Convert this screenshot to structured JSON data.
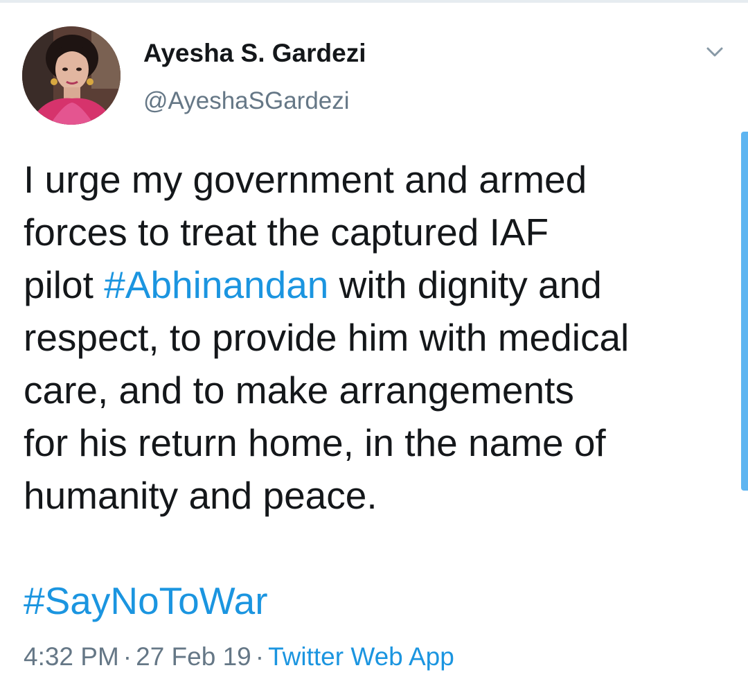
{
  "tweet": {
    "author": {
      "display_name": "Ayesha S. Gardezi",
      "handle": "@AyeshaSGardezi"
    },
    "text_lines": [
      {
        "before": "I urge my government and armed",
        "hashtag": "",
        "after": ""
      },
      {
        "before": "forces to treat the captured IAF",
        "hashtag": "",
        "after": ""
      },
      {
        "before": "pilot ",
        "hashtag": "#Abhinandan",
        "after": " with dignity and"
      },
      {
        "before": "respect, to provide him with medical",
        "hashtag": "",
        "after": ""
      },
      {
        "before": "care, and to make arrangements",
        "hashtag": "",
        "after": ""
      },
      {
        "before": "for his return home, in the name of",
        "hashtag": "",
        "after": ""
      },
      {
        "before": "humanity and peace.",
        "hashtag": "",
        "after": ""
      }
    ],
    "hashtag_line": "#SayNoToWar",
    "time": "4:32 PM",
    "separator": "·",
    "date": "27 Feb 19",
    "source": "Twitter Web App"
  },
  "icons": {
    "caret": "chevron-down-icon",
    "avatar": "profile-photo"
  },
  "colors": {
    "text": "#14171a",
    "secondary": "#657786",
    "link": "#1b95e0",
    "scrollbar": "#5eb5f1"
  }
}
